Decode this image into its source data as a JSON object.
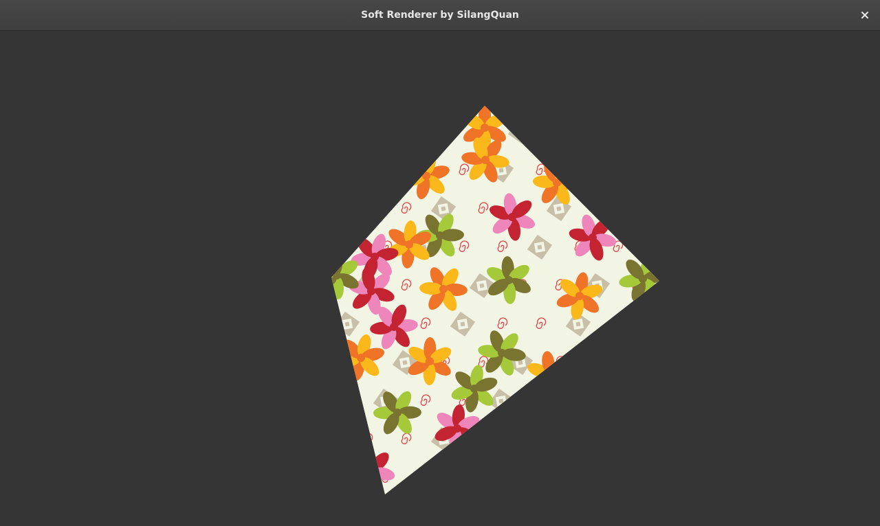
{
  "window": {
    "title": "Soft Renderer by SilangQuan",
    "close_icon": "close-icon"
  },
  "render": {
    "background_color": "#353535",
    "texture_base_color": "#f2f5e4",
    "texture_palette": [
      "#ef7428",
      "#fbb81b",
      "#ee86bb",
      "#c42331",
      "#a6c93a",
      "#7a7431",
      "#c8bfa8",
      "#e8424a"
    ]
  }
}
